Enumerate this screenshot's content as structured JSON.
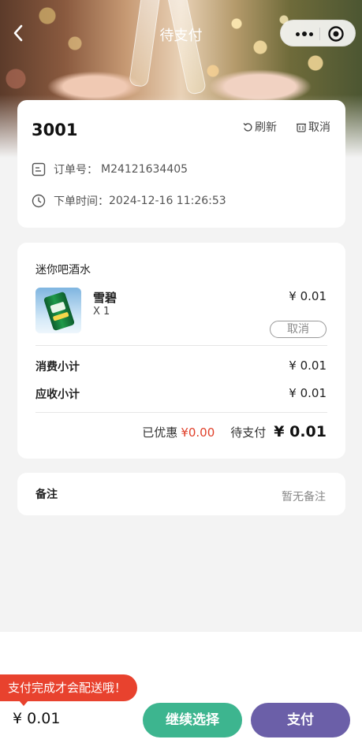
{
  "nav": {
    "title": "待支付"
  },
  "order": {
    "table_no": "3001",
    "refresh_label": "刷新",
    "cancel_label": "取消",
    "order_no_label": "订单号：",
    "order_no": "M24121634405",
    "time_label": "下单时间：",
    "time": "2024-12-16 11:26:53"
  },
  "items": {
    "section_title": "迷你吧酒水",
    "list": [
      {
        "name": "雪碧",
        "qty": "X 1",
        "price": "¥ 0.01",
        "cancel_label": "取消"
      }
    ],
    "consume_label": "消费小计",
    "consume_value": "¥ 0.01",
    "receivable_label": "应收小计",
    "receivable_value": "¥ 0.01",
    "discount_label": "已优惠",
    "discount_value": "¥0.00",
    "pending_label": "待支付",
    "pending_value": "¥ 0.01"
  },
  "remark": {
    "label": "备注",
    "value": "暂无备注"
  },
  "footer": {
    "tip": "支付完成才会配送哦！",
    "total": "¥ 0.01",
    "continue_label": "继续选择",
    "pay_label": "支付"
  },
  "colors": {
    "continue": "#3db58f",
    "pay": "#6b5fa8",
    "tip": "#e8422e",
    "discount": "#e0402a"
  }
}
